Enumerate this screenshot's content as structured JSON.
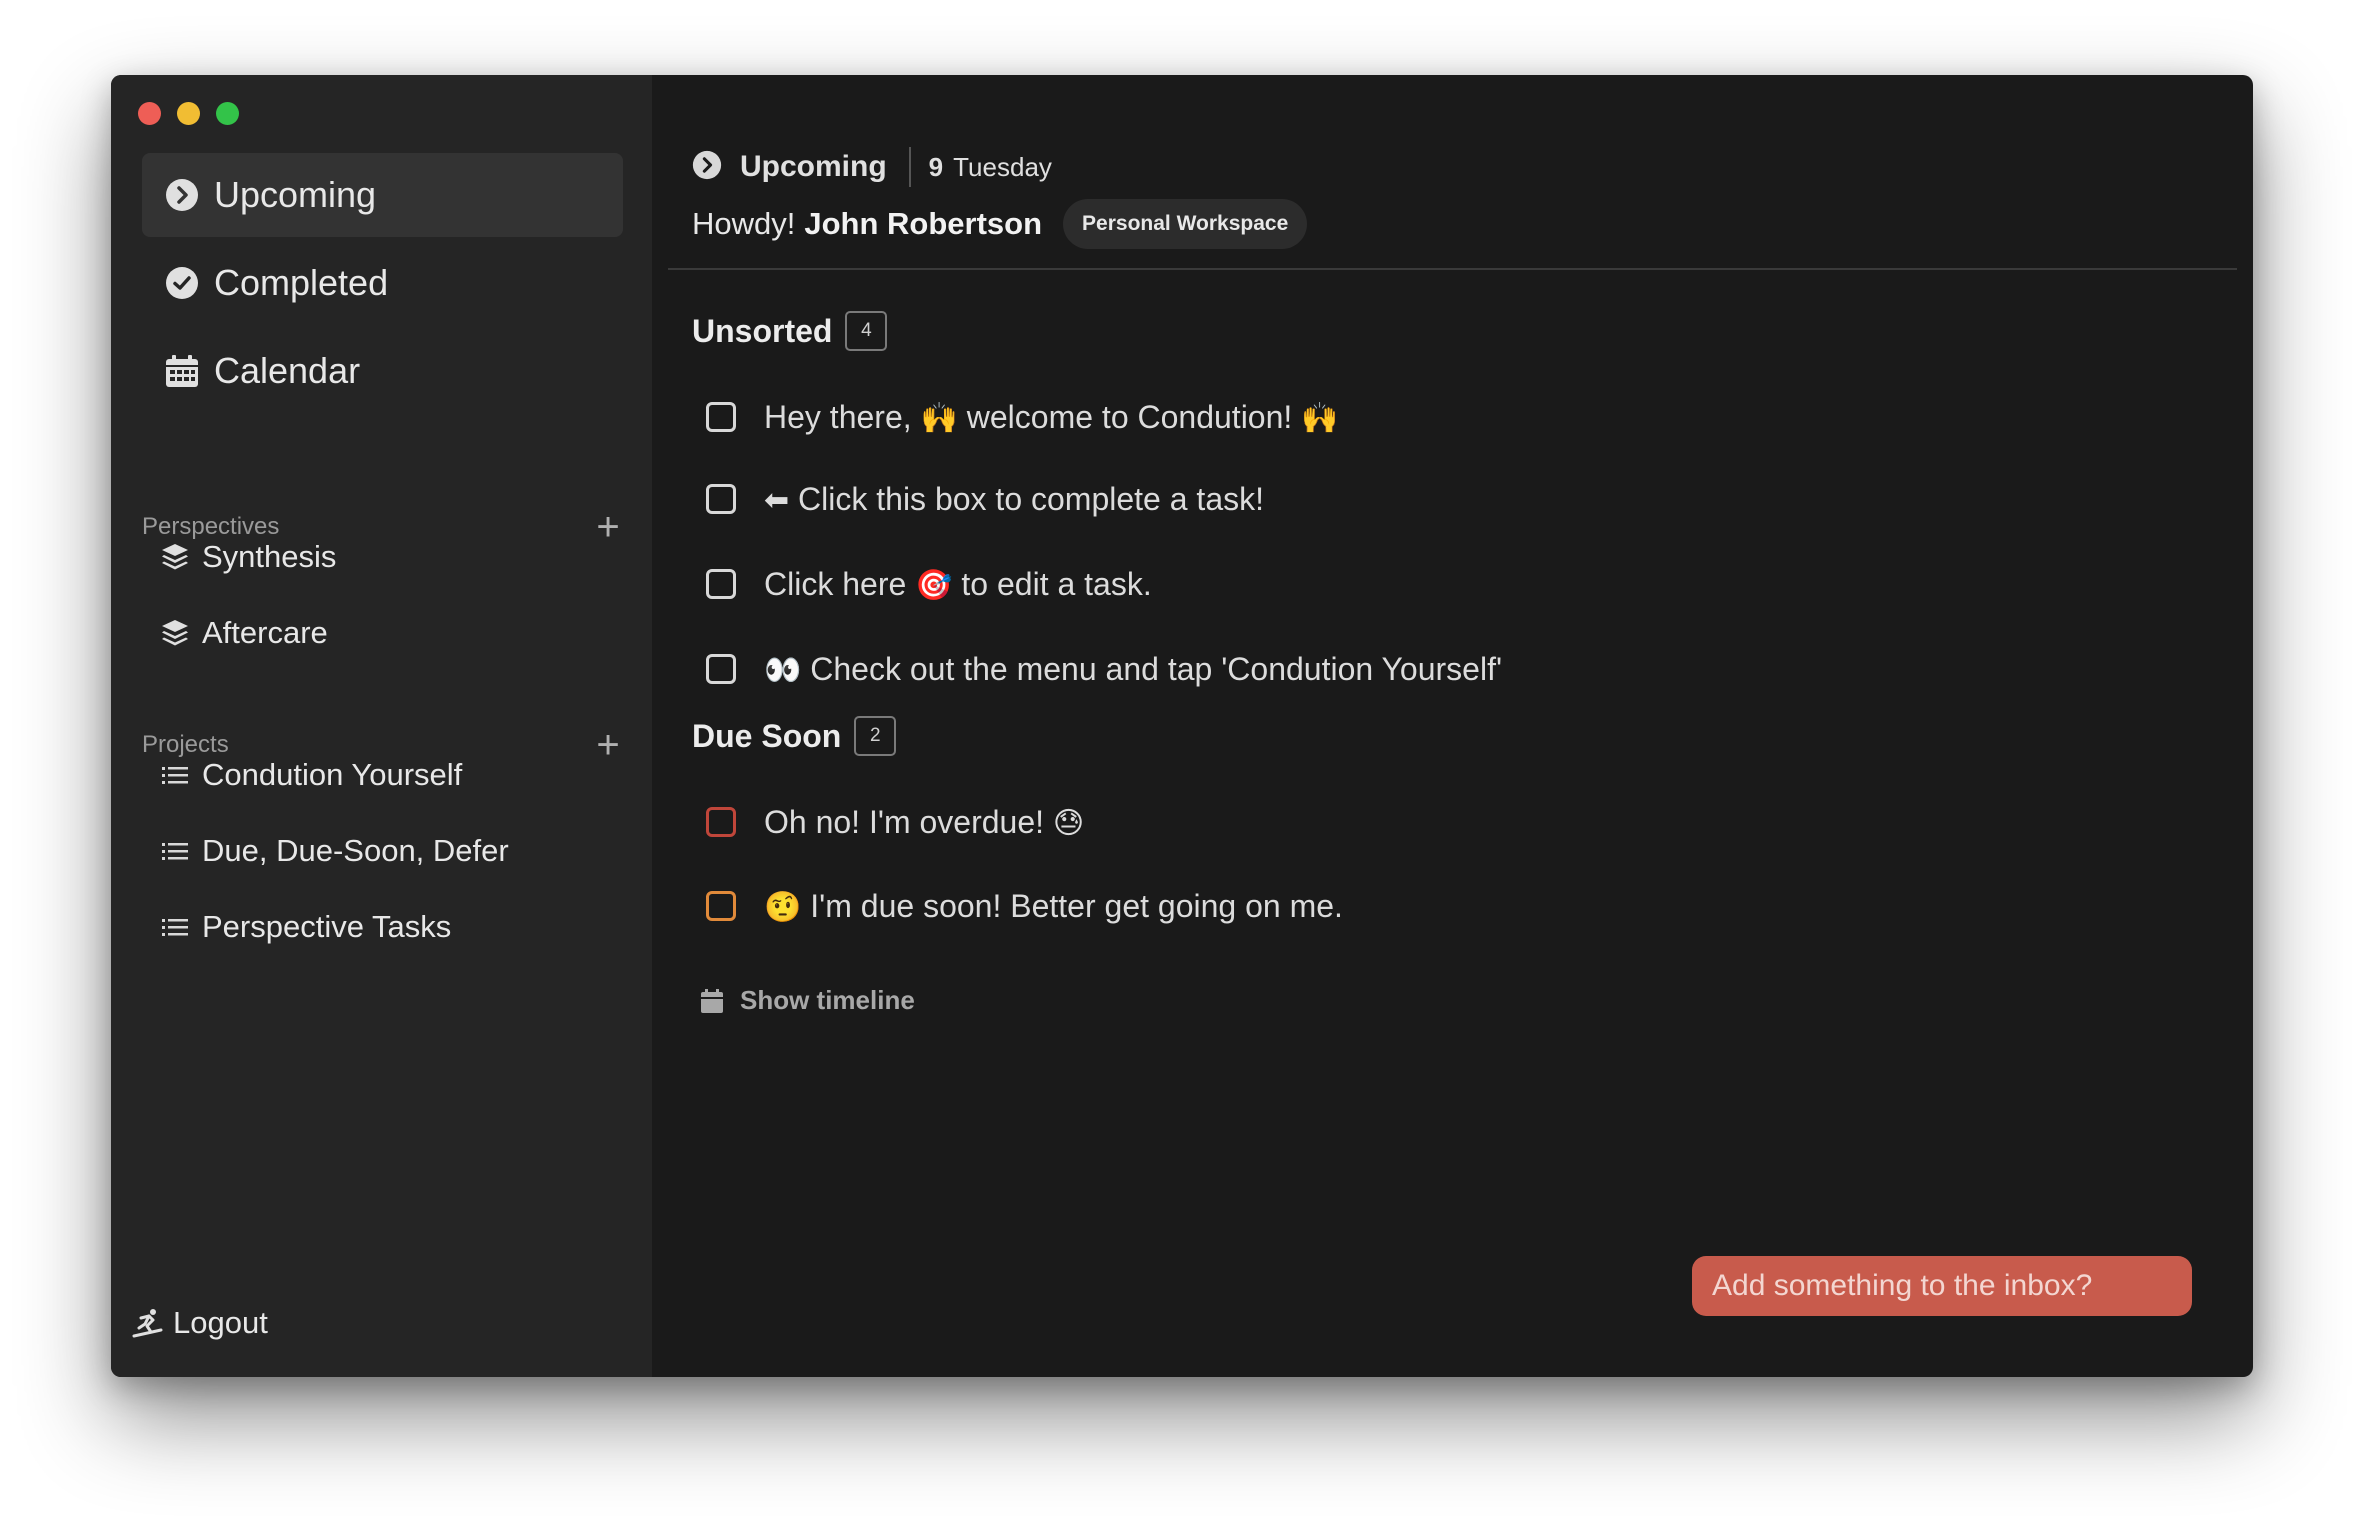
{
  "sidebar": {
    "nav": [
      {
        "label": "Upcoming",
        "icon": "chevron-right-circle-icon"
      },
      {
        "label": "Completed",
        "icon": "check-circle-icon"
      },
      {
        "label": "Calendar",
        "icon": "calendar-icon"
      }
    ],
    "perspectives_header": "Perspectives",
    "perspectives": [
      {
        "label": "Synthesis",
        "icon": "layers-icon"
      },
      {
        "label": "Aftercare",
        "icon": "layers-icon"
      }
    ],
    "projects_header": "Projects",
    "projects": [
      {
        "label": "Condution Yourself",
        "icon": "list-icon"
      },
      {
        "label": "Due, Due-Soon, Defer",
        "icon": "list-icon"
      },
      {
        "label": "Perspective Tasks",
        "icon": "list-icon"
      }
    ],
    "logout_label": "Logout"
  },
  "header": {
    "title": "Upcoming",
    "day_number": "9",
    "day_name": "Tuesday",
    "greeting": "Howdy!",
    "user_name": "John Robertson",
    "workspace": "Personal Workspace"
  },
  "groups": [
    {
      "title": "Unsorted",
      "count": "4",
      "tasks": [
        {
          "before": "Hey there, ",
          "emoji1": "🙌",
          "middle": " welcome to Condution! ",
          "emoji2": "🙌"
        },
        {
          "emoji": "⬅",
          "text": " Click this box to complete a task!"
        },
        {
          "before": "Click here ",
          "emoji": "🎯",
          "after": " to edit a task."
        },
        {
          "emoji": "👀",
          "text": " Check out the menu and tap 'Condution Yourself'"
        }
      ]
    },
    {
      "title": "Due Soon",
      "count": "2",
      "tasks": [
        {
          "text": "Oh no! I'm overdue! ",
          "emoji": "😓",
          "status": "overdue"
        },
        {
          "emoji": "🤨",
          "text": " I'm due soon! Better get going on me.",
          "status": "soon"
        }
      ]
    }
  ],
  "show_timeline_label": "Show timeline",
  "inbox": {
    "placeholder": "Add something to the inbox?"
  },
  "colors": {
    "overdue": "#c0463a",
    "due_soon": "#e18a3a",
    "inbox_accent": "#c85b4c"
  }
}
